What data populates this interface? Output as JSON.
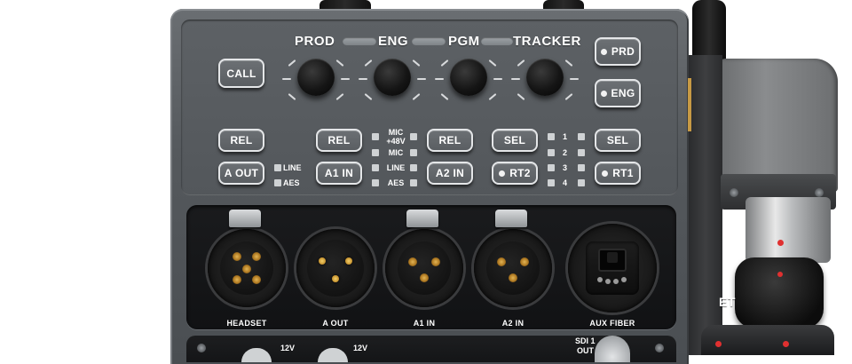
{
  "channels": {
    "prod": "PROD",
    "eng": "ENG",
    "pgm": "PGM",
    "tracker": "TRACKER"
  },
  "buttons": {
    "call": "CALL",
    "prd": "PRD",
    "eng": "ENG",
    "rel_1": "REL",
    "rel_2": "REL",
    "rel_3": "REL",
    "sel_1": "SEL",
    "sel_2": "SEL",
    "a_out": "A OUT",
    "a1_in": "A1 IN",
    "a2_in": "A2 IN",
    "rt2": "RT2",
    "rt1": "RT1"
  },
  "indicators": {
    "line": "LINE",
    "aes": "AES",
    "mic_48v_1": "MIC",
    "mic_48v_2": "+48V",
    "mic": "MIC",
    "line_2": "LINE",
    "aes_2": "AES",
    "num_1": "1",
    "num_2": "2",
    "num_3": "3",
    "num_4": "4"
  },
  "connectors": {
    "headset": "HEADSET",
    "a_out": "A OUT",
    "a1_in": "A1 IN",
    "a2_in": "A2 IN",
    "aux_fiber": "AUX FIBER"
  },
  "bottom": {
    "v12_1": "12V",
    "v12_2": "12V",
    "sdi_1": "SDI 1",
    "sdi_out": "OUT"
  },
  "side_module": {
    "label": "ET"
  },
  "colors": {
    "panel": "#55595d",
    "button_border": "#e4e6e8",
    "pin_gold": "#c4902c",
    "led_red": "#e03030"
  }
}
